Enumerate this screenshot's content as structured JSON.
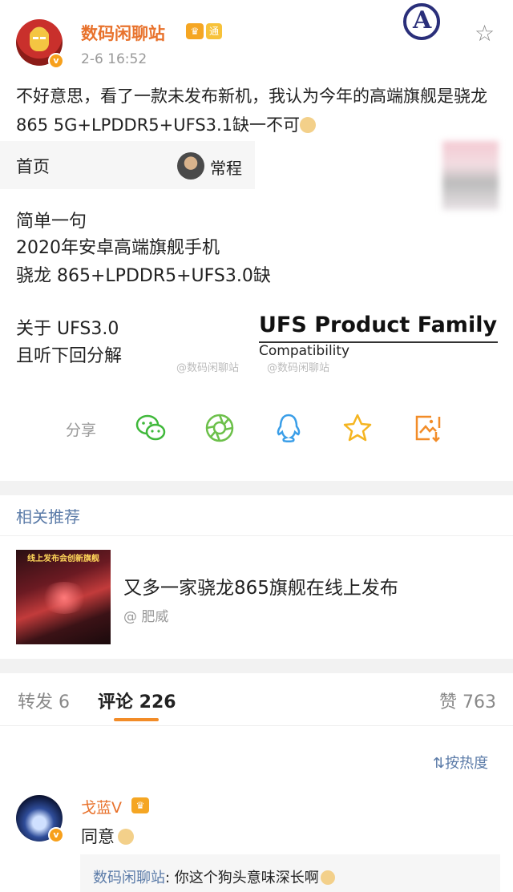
{
  "post": {
    "username": "数码闲聊站",
    "time": "2-6 16:52",
    "text": "不好意思，看了一款未发布新机，我认为今年的高端旗舰是骁龙865 5G+LPDDR5+UFS3.1缺一不可",
    "badges": [
      "crown",
      "bus"
    ]
  },
  "embed": {
    "home_label": "首页",
    "author_name": "常程",
    "lines": [
      "简单一句",
      "2020年安卓高端旗舰手机",
      "骁龙 865+LPDDR5+UFS3.0缺",
      "关于 UFS3.0",
      "且听下回分解"
    ],
    "product_family_title": "UFS Product Family",
    "product_family_sub": "Compatibility",
    "watermarks": [
      "@数码闲聊站",
      "@数码闲聊站"
    ]
  },
  "share": {
    "label": "分享",
    "icons": [
      "wechat-icon",
      "moments-icon",
      "qq-icon",
      "qzone-star-icon",
      "save-image-icon"
    ],
    "colors": {
      "wechat": "#3fb83a",
      "moments": "#6cc04a",
      "qq": "#3a9ee8",
      "star": "#f5b521",
      "save": "#f28c28"
    }
  },
  "related": {
    "section_title": "相关推荐",
    "headline": "又多一家骁龙865旗舰在线上发布",
    "author": "@ 肥威",
    "thumb_banner": "线上发布会创新旗舰"
  },
  "tabs": {
    "repost": "转发 6",
    "comments": "评论 226",
    "likes": "赞 763"
  },
  "sort": {
    "label": "按热度"
  },
  "comment": {
    "username": "戈蓝V",
    "text": "同意",
    "reply_user": "数码闲聊站",
    "reply_text": ": 你这个狗头意味深长啊"
  },
  "colors": {
    "accent_orange": "#e8722c",
    "link_blue": "#5b7ba8",
    "tab_underline": "#f28c28"
  }
}
